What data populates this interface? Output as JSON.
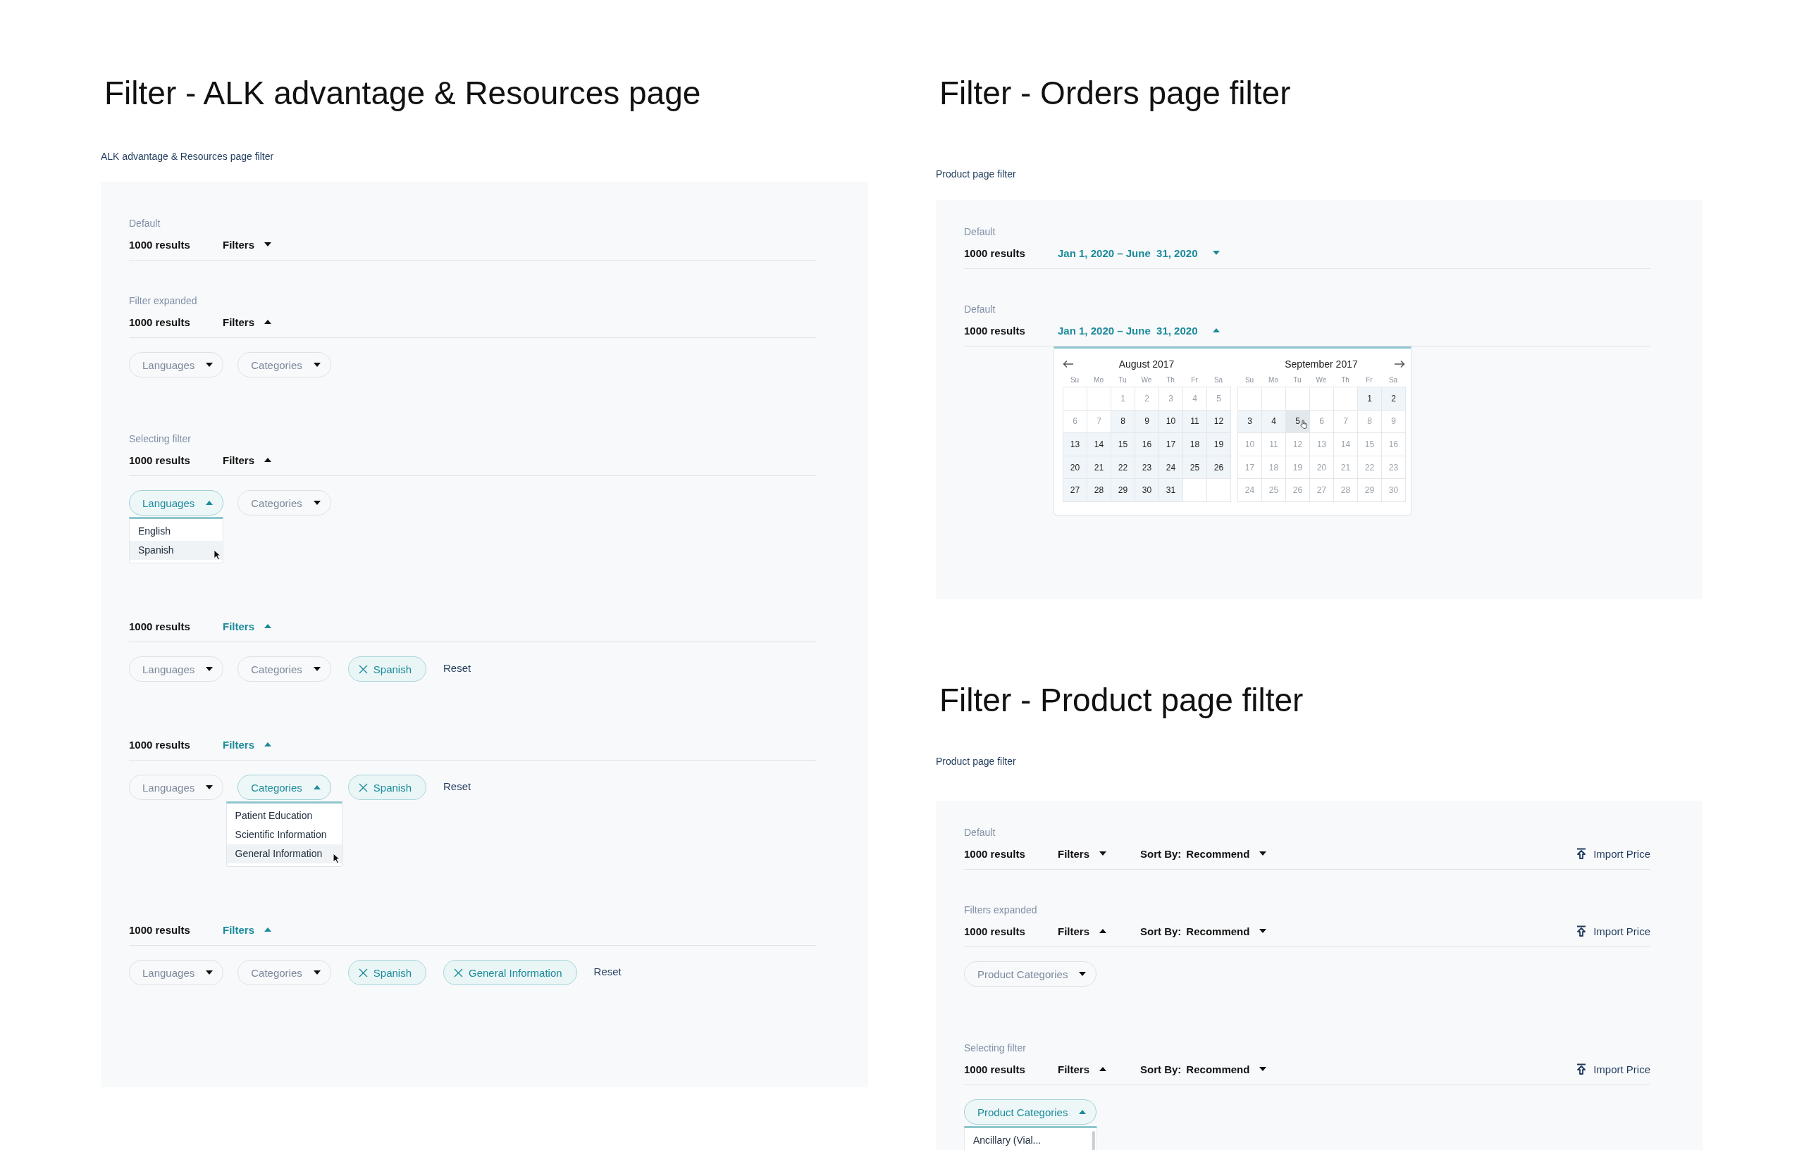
{
  "sections": [
    {
      "title": "Filter - ALK advantage & Resources page",
      "caption": "ALK advantage & Resources page filter",
      "states": [
        {
          "label": "Default",
          "results": "1000 results",
          "controls": [
            {
              "kind": "filters",
              "text": "Filters",
              "expanded": false,
              "active": false
            }
          ]
        },
        {
          "label": "Filter expanded",
          "results": "1000 results",
          "controls": [
            {
              "kind": "filters",
              "text": "Filters",
              "expanded": true,
              "active": false
            }
          ],
          "pills": [
            {
              "kind": "select",
              "text": "Languages",
              "open": false
            },
            {
              "kind": "select",
              "text": "Categories",
              "open": false
            }
          ]
        },
        {
          "label": "Selecting filter",
          "results": "1000 results",
          "controls": [
            {
              "kind": "filters",
              "text": "Filters",
              "expanded": true,
              "active": false
            }
          ],
          "pills": [
            {
              "kind": "select",
              "text": "Languages",
              "open": true,
              "options": [
                {
                  "text": "English",
                  "hovered": false
                },
                {
                  "text": "Spanish",
                  "hovered": true
                }
              ]
            },
            {
              "kind": "select",
              "text": "Categories",
              "open": false
            }
          ]
        },
        {
          "results": "1000 results",
          "controls": [
            {
              "kind": "filters",
              "text": "Filters",
              "expanded": true,
              "active": true
            }
          ],
          "pills": [
            {
              "kind": "select",
              "text": "Languages",
              "open": false
            },
            {
              "kind": "select",
              "text": "Categories",
              "open": false
            },
            {
              "kind": "tag",
              "text": "Spanish"
            },
            {
              "kind": "reset",
              "text": "Reset"
            }
          ]
        },
        {
          "results": "1000 results",
          "controls": [
            {
              "kind": "filters",
              "text": "Filters",
              "expanded": true,
              "active": true
            }
          ],
          "pills": [
            {
              "kind": "select",
              "text": "Languages",
              "open": false
            },
            {
              "kind": "select",
              "text": "Categories",
              "open": true,
              "options": [
                {
                  "text": "Patient Education",
                  "hovered": false
                },
                {
                  "text": "Scientific Information",
                  "hovered": false
                },
                {
                  "text": "General Information",
                  "hovered": true
                }
              ]
            },
            {
              "kind": "tag",
              "text": "Spanish"
            },
            {
              "kind": "reset",
              "text": "Reset"
            }
          ]
        },
        {
          "results": "1000 results",
          "controls": [
            {
              "kind": "filters",
              "text": "Filters",
              "expanded": true,
              "active": true
            }
          ],
          "pills": [
            {
              "kind": "select",
              "text": "Languages",
              "open": false
            },
            {
              "kind": "select",
              "text": "Categories",
              "open": false
            },
            {
              "kind": "tag",
              "text": "Spanish"
            },
            {
              "kind": "tag",
              "text": "General Information"
            },
            {
              "kind": "reset",
              "text": "Reset"
            }
          ]
        }
      ]
    },
    {
      "title": "Filter - Orders page filter",
      "caption": "Product page filter",
      "states": [
        {
          "label": "Default",
          "results": "1000 results",
          "controls": [
            {
              "kind": "date",
              "text": "Jan 1, 2020 – June  31, 2020",
              "expanded": false
            }
          ]
        },
        {
          "label": "Default",
          "results": "1000 results",
          "controls": [
            {
              "kind": "date",
              "text": "Jan 1, 2020 – June  31, 2020",
              "expanded": true
            }
          ],
          "calendar": {
            "months": [
              {
                "title": "August 2017",
                "weekdays": [
                  "Su",
                  "Mo",
                  "Tu",
                  "We",
                  "Th",
                  "Fr",
                  "Sa"
                ],
                "weeks": [
                  {
                    "pad_start": true,
                    "days": [
                      {
                        "day": "1",
                        "in_range": false,
                        "hovered": false
                      },
                      {
                        "day": "2",
                        "in_range": false,
                        "hovered": false
                      },
                      {
                        "day": "3",
                        "in_range": false,
                        "hovered": false
                      },
                      {
                        "day": "4",
                        "in_range": false,
                        "hovered": false
                      },
                      {
                        "day": "5",
                        "in_range": false,
                        "hovered": false
                      }
                    ]
                  },
                  {
                    "days": [
                      {
                        "day": "6",
                        "in_range": false,
                        "hovered": false
                      },
                      {
                        "day": "7",
                        "in_range": false,
                        "hovered": false
                      },
                      {
                        "day": "8",
                        "in_range": true,
                        "hovered": false
                      },
                      {
                        "day": "9",
                        "in_range": true,
                        "hovered": false
                      },
                      {
                        "day": "10",
                        "in_range": true,
                        "hovered": false
                      },
                      {
                        "day": "11",
                        "in_range": true,
                        "hovered": false
                      },
                      {
                        "day": "12",
                        "in_range": true,
                        "hovered": false
                      }
                    ]
                  },
                  {
                    "days": [
                      {
                        "day": "13",
                        "in_range": true,
                        "hovered": false
                      },
                      {
                        "day": "14",
                        "in_range": true,
                        "hovered": false
                      },
                      {
                        "day": "15",
                        "in_range": true,
                        "hovered": false
                      },
                      {
                        "day": "16",
                        "in_range": true,
                        "hovered": false
                      },
                      {
                        "day": "17",
                        "in_range": true,
                        "hovered": false
                      },
                      {
                        "day": "18",
                        "in_range": true,
                        "hovered": false
                      },
                      {
                        "day": "19",
                        "in_range": true,
                        "hovered": false
                      }
                    ]
                  },
                  {
                    "days": [
                      {
                        "day": "20",
                        "in_range": true,
                        "hovered": false
                      },
                      {
                        "day": "21",
                        "in_range": true,
                        "hovered": false
                      },
                      {
                        "day": "22",
                        "in_range": true,
                        "hovered": false
                      },
                      {
                        "day": "23",
                        "in_range": true,
                        "hovered": false
                      },
                      {
                        "day": "24",
                        "in_range": true,
                        "hovered": false
                      },
                      {
                        "day": "25",
                        "in_range": true,
                        "hovered": false
                      },
                      {
                        "day": "26",
                        "in_range": true,
                        "hovered": false
                      }
                    ]
                  },
                  {
                    "pad_start": false,
                    "days": [
                      {
                        "day": "27",
                        "in_range": true,
                        "hovered": false
                      },
                      {
                        "day": "28",
                        "in_range": true,
                        "hovered": false
                      },
                      {
                        "day": "29",
                        "in_range": true,
                        "hovered": false
                      },
                      {
                        "day": "30",
                        "in_range": true,
                        "hovered": false
                      },
                      {
                        "day": "31",
                        "in_range": true,
                        "hovered": false
                      }
                    ]
                  }
                ]
              },
              {
                "title": "September 2017",
                "weekdays": [
                  "Su",
                  "Mo",
                  "Tu",
                  "We",
                  "Th",
                  "Fr",
                  "Sa"
                ],
                "weeks": [
                  {
                    "pad_start": true,
                    "days": [
                      {
                        "day": "1",
                        "in_range": true,
                        "hovered": false
                      },
                      {
                        "day": "2",
                        "in_range": true,
                        "hovered": false
                      }
                    ]
                  },
                  {
                    "days": [
                      {
                        "day": "3",
                        "in_range": true,
                        "hovered": false
                      },
                      {
                        "day": "4",
                        "in_range": true,
                        "hovered": false
                      },
                      {
                        "day": "5",
                        "in_range": false,
                        "hovered": true
                      },
                      {
                        "day": "6",
                        "in_range": false,
                        "hovered": false
                      },
                      {
                        "day": "7",
                        "in_range": false,
                        "hovered": false
                      },
                      {
                        "day": "8",
                        "in_range": false,
                        "hovered": false
                      },
                      {
                        "day": "9",
                        "in_range": false,
                        "hovered": false
                      }
                    ]
                  },
                  {
                    "days": [
                      {
                        "day": "10",
                        "in_range": false,
                        "hovered": false
                      },
                      {
                        "day": "11",
                        "in_range": false,
                        "hovered": false
                      },
                      {
                        "day": "12",
                        "in_range": false,
                        "hovered": false
                      },
                      {
                        "day": "13",
                        "in_range": false,
                        "hovered": false
                      },
                      {
                        "day": "14",
                        "in_range": false,
                        "hovered": false
                      },
                      {
                        "day": "15",
                        "in_range": false,
                        "hovered": false
                      },
                      {
                        "day": "16",
                        "in_range": false,
                        "hovered": false
                      }
                    ]
                  },
                  {
                    "days": [
                      {
                        "day": "17",
                        "in_range": false,
                        "hovered": false
                      },
                      {
                        "day": "18",
                        "in_range": false,
                        "hovered": false
                      },
                      {
                        "day": "19",
                        "in_range": false,
                        "hovered": false
                      },
                      {
                        "day": "20",
                        "in_range": false,
                        "hovered": false
                      },
                      {
                        "day": "21",
                        "in_range": false,
                        "hovered": false
                      },
                      {
                        "day": "22",
                        "in_range": false,
                        "hovered": false
                      },
                      {
                        "day": "23",
                        "in_range": false,
                        "hovered": false
                      }
                    ]
                  },
                  {
                    "days": [
                      {
                        "day": "24",
                        "in_range": false,
                        "hovered": false
                      },
                      {
                        "day": "25",
                        "in_range": false,
                        "hovered": false
                      },
                      {
                        "day": "26",
                        "in_range": false,
                        "hovered": false
                      },
                      {
                        "day": "27",
                        "in_range": false,
                        "hovered": false
                      },
                      {
                        "day": "28",
                        "in_range": false,
                        "hovered": false
                      },
                      {
                        "day": "29",
                        "in_range": false,
                        "hovered": false
                      },
                      {
                        "day": "30",
                        "in_range": false,
                        "hovered": false
                      }
                    ]
                  }
                ]
              }
            ]
          }
        }
      ]
    },
    {
      "title": "Filter - Product page filter",
      "caption": "Product page filter",
      "states": [
        {
          "label": "Default",
          "results": "1000 results",
          "controls": [
            {
              "kind": "filters",
              "text": "Filters",
              "expanded": false,
              "active": false
            },
            {
              "kind": "sort",
              "prefix": "Sort By:",
              "text": "Recommend",
              "expanded": false
            }
          ],
          "action": {
            "text": "Import Price"
          }
        },
        {
          "label": "Filters expanded",
          "results": "1000 results",
          "controls": [
            {
              "kind": "filters",
              "text": "Filters",
              "expanded": true,
              "active": false
            },
            {
              "kind": "sort",
              "prefix": "Sort By:",
              "text": "Recommend",
              "expanded": false
            }
          ],
          "action": {
            "text": "Import Price"
          },
          "pills": [
            {
              "kind": "select",
              "text": "Product Categories",
              "open": false
            }
          ]
        },
        {
          "label": "Selecting filter",
          "results": "1000 results",
          "controls": [
            {
              "kind": "filters",
              "text": "Filters",
              "expanded": true,
              "active": false
            },
            {
              "kind": "sort",
              "prefix": "Sort By:",
              "text": "Recommend",
              "expanded": false
            }
          ],
          "action": {
            "text": "Import Price"
          },
          "pills": [
            {
              "kind": "select",
              "text": "Product Categories",
              "open": true,
              "scrollable": true,
              "options": [
                {
                  "text": "Ancillary (Vial...",
                  "hovered": false
                }
              ]
            }
          ]
        }
      ]
    }
  ]
}
